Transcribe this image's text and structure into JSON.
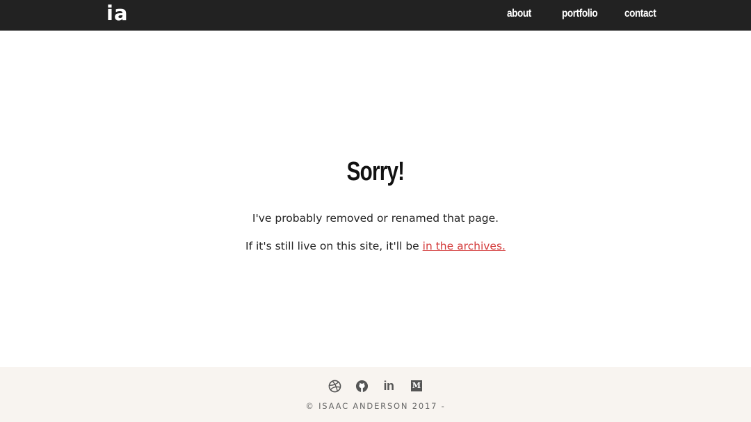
{
  "nav": {
    "logo": "ia",
    "links": [
      "about",
      "portfolio",
      "contact"
    ]
  },
  "main": {
    "title": "Sorry!",
    "line1": "I've probably removed or renamed that page.",
    "line2_prefix": "If it's still live on this site, it'll be ",
    "archive_link": "in the archives."
  },
  "footer": {
    "social": [
      "dribbble-icon",
      "github-icon",
      "linkedin-icon",
      "medium-icon"
    ],
    "linkedin_text": "in",
    "medium_text": "M",
    "copyright": "© ISAAC ANDERSON 2017 -"
  },
  "colors": {
    "nav_bg": "#222222",
    "link_accent": "#d33a3a",
    "footer_bg": "#f8f4f0"
  }
}
